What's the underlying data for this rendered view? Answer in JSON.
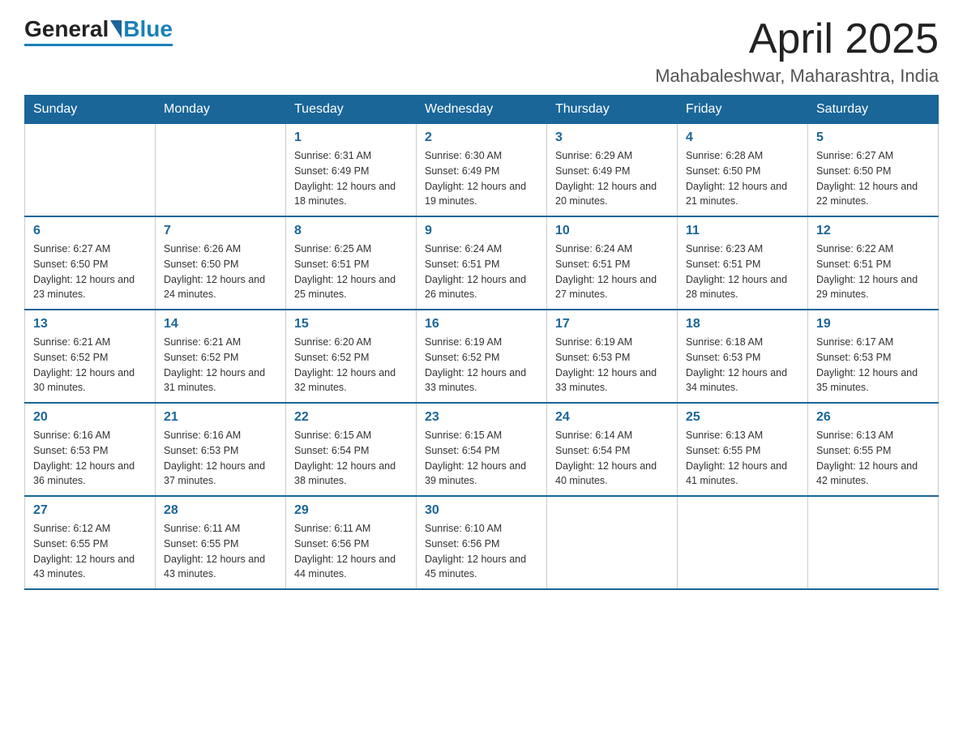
{
  "header": {
    "logo": {
      "general": "General",
      "blue": "Blue"
    },
    "title": "April 2025",
    "location": "Mahabaleshwar, Maharashtra, India"
  },
  "days_of_week": [
    "Sunday",
    "Monday",
    "Tuesday",
    "Wednesday",
    "Thursday",
    "Friday",
    "Saturday"
  ],
  "weeks": [
    [
      {
        "day": "",
        "sunrise": "",
        "sunset": "",
        "daylight": ""
      },
      {
        "day": "",
        "sunrise": "",
        "sunset": "",
        "daylight": ""
      },
      {
        "day": "1",
        "sunrise": "Sunrise: 6:31 AM",
        "sunset": "Sunset: 6:49 PM",
        "daylight": "Daylight: 12 hours and 18 minutes."
      },
      {
        "day": "2",
        "sunrise": "Sunrise: 6:30 AM",
        "sunset": "Sunset: 6:49 PM",
        "daylight": "Daylight: 12 hours and 19 minutes."
      },
      {
        "day": "3",
        "sunrise": "Sunrise: 6:29 AM",
        "sunset": "Sunset: 6:49 PM",
        "daylight": "Daylight: 12 hours and 20 minutes."
      },
      {
        "day": "4",
        "sunrise": "Sunrise: 6:28 AM",
        "sunset": "Sunset: 6:50 PM",
        "daylight": "Daylight: 12 hours and 21 minutes."
      },
      {
        "day": "5",
        "sunrise": "Sunrise: 6:27 AM",
        "sunset": "Sunset: 6:50 PM",
        "daylight": "Daylight: 12 hours and 22 minutes."
      }
    ],
    [
      {
        "day": "6",
        "sunrise": "Sunrise: 6:27 AM",
        "sunset": "Sunset: 6:50 PM",
        "daylight": "Daylight: 12 hours and 23 minutes."
      },
      {
        "day": "7",
        "sunrise": "Sunrise: 6:26 AM",
        "sunset": "Sunset: 6:50 PM",
        "daylight": "Daylight: 12 hours and 24 minutes."
      },
      {
        "day": "8",
        "sunrise": "Sunrise: 6:25 AM",
        "sunset": "Sunset: 6:51 PM",
        "daylight": "Daylight: 12 hours and 25 minutes."
      },
      {
        "day": "9",
        "sunrise": "Sunrise: 6:24 AM",
        "sunset": "Sunset: 6:51 PM",
        "daylight": "Daylight: 12 hours and 26 minutes."
      },
      {
        "day": "10",
        "sunrise": "Sunrise: 6:24 AM",
        "sunset": "Sunset: 6:51 PM",
        "daylight": "Daylight: 12 hours and 27 minutes."
      },
      {
        "day": "11",
        "sunrise": "Sunrise: 6:23 AM",
        "sunset": "Sunset: 6:51 PM",
        "daylight": "Daylight: 12 hours and 28 minutes."
      },
      {
        "day": "12",
        "sunrise": "Sunrise: 6:22 AM",
        "sunset": "Sunset: 6:51 PM",
        "daylight": "Daylight: 12 hours and 29 minutes."
      }
    ],
    [
      {
        "day": "13",
        "sunrise": "Sunrise: 6:21 AM",
        "sunset": "Sunset: 6:52 PM",
        "daylight": "Daylight: 12 hours and 30 minutes."
      },
      {
        "day": "14",
        "sunrise": "Sunrise: 6:21 AM",
        "sunset": "Sunset: 6:52 PM",
        "daylight": "Daylight: 12 hours and 31 minutes."
      },
      {
        "day": "15",
        "sunrise": "Sunrise: 6:20 AM",
        "sunset": "Sunset: 6:52 PM",
        "daylight": "Daylight: 12 hours and 32 minutes."
      },
      {
        "day": "16",
        "sunrise": "Sunrise: 6:19 AM",
        "sunset": "Sunset: 6:52 PM",
        "daylight": "Daylight: 12 hours and 33 minutes."
      },
      {
        "day": "17",
        "sunrise": "Sunrise: 6:19 AM",
        "sunset": "Sunset: 6:53 PM",
        "daylight": "Daylight: 12 hours and 33 minutes."
      },
      {
        "day": "18",
        "sunrise": "Sunrise: 6:18 AM",
        "sunset": "Sunset: 6:53 PM",
        "daylight": "Daylight: 12 hours and 34 minutes."
      },
      {
        "day": "19",
        "sunrise": "Sunrise: 6:17 AM",
        "sunset": "Sunset: 6:53 PM",
        "daylight": "Daylight: 12 hours and 35 minutes."
      }
    ],
    [
      {
        "day": "20",
        "sunrise": "Sunrise: 6:16 AM",
        "sunset": "Sunset: 6:53 PM",
        "daylight": "Daylight: 12 hours and 36 minutes."
      },
      {
        "day": "21",
        "sunrise": "Sunrise: 6:16 AM",
        "sunset": "Sunset: 6:53 PM",
        "daylight": "Daylight: 12 hours and 37 minutes."
      },
      {
        "day": "22",
        "sunrise": "Sunrise: 6:15 AM",
        "sunset": "Sunset: 6:54 PM",
        "daylight": "Daylight: 12 hours and 38 minutes."
      },
      {
        "day": "23",
        "sunrise": "Sunrise: 6:15 AM",
        "sunset": "Sunset: 6:54 PM",
        "daylight": "Daylight: 12 hours and 39 minutes."
      },
      {
        "day": "24",
        "sunrise": "Sunrise: 6:14 AM",
        "sunset": "Sunset: 6:54 PM",
        "daylight": "Daylight: 12 hours and 40 minutes."
      },
      {
        "day": "25",
        "sunrise": "Sunrise: 6:13 AM",
        "sunset": "Sunset: 6:55 PM",
        "daylight": "Daylight: 12 hours and 41 minutes."
      },
      {
        "day": "26",
        "sunrise": "Sunrise: 6:13 AM",
        "sunset": "Sunset: 6:55 PM",
        "daylight": "Daylight: 12 hours and 42 minutes."
      }
    ],
    [
      {
        "day": "27",
        "sunrise": "Sunrise: 6:12 AM",
        "sunset": "Sunset: 6:55 PM",
        "daylight": "Daylight: 12 hours and 43 minutes."
      },
      {
        "day": "28",
        "sunrise": "Sunrise: 6:11 AM",
        "sunset": "Sunset: 6:55 PM",
        "daylight": "Daylight: 12 hours and 43 minutes."
      },
      {
        "day": "29",
        "sunrise": "Sunrise: 6:11 AM",
        "sunset": "Sunset: 6:56 PM",
        "daylight": "Daylight: 12 hours and 44 minutes."
      },
      {
        "day": "30",
        "sunrise": "Sunrise: 6:10 AM",
        "sunset": "Sunset: 6:56 PM",
        "daylight": "Daylight: 12 hours and 45 minutes."
      },
      {
        "day": "",
        "sunrise": "",
        "sunset": "",
        "daylight": ""
      },
      {
        "day": "",
        "sunrise": "",
        "sunset": "",
        "daylight": ""
      },
      {
        "day": "",
        "sunrise": "",
        "sunset": "",
        "daylight": ""
      }
    ]
  ]
}
